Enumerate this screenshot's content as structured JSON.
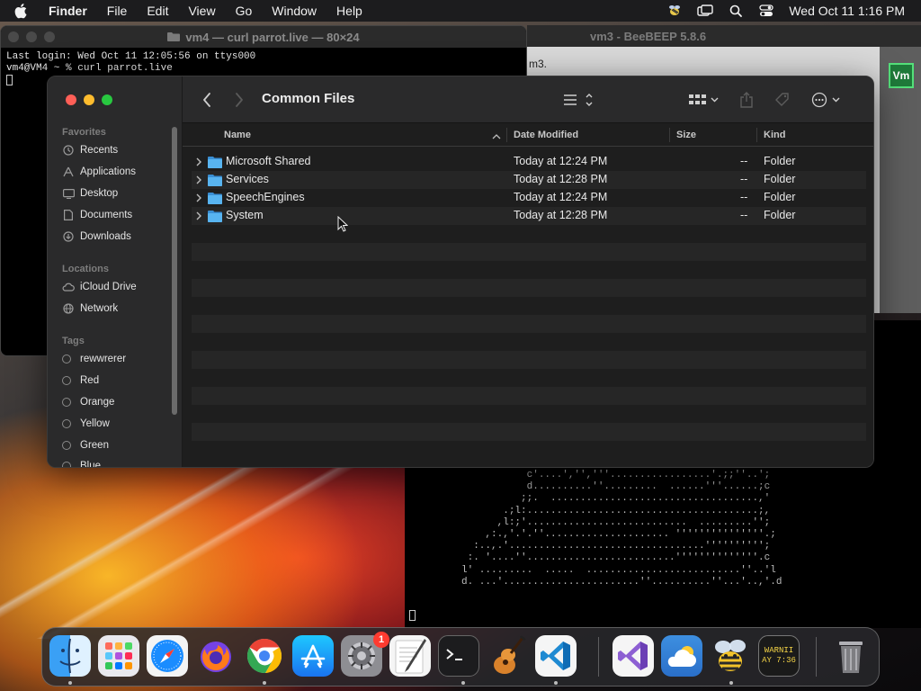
{
  "menubar": {
    "app_name": "Finder",
    "items": [
      "File",
      "Edit",
      "View",
      "Go",
      "Window",
      "Help"
    ],
    "datetime": "Wed Oct 11  1:16 PM"
  },
  "terminal": {
    "title": "vm4 — curl parrot.live — 80×24",
    "line1": "Last login: Wed Oct 11 12:05:56 on ttys000",
    "line2": "vm4@VM4 ~ % curl parrot.live"
  },
  "beebeep": {
    "title": "vm3 - BeeBEEP 5.8.6",
    "text": "m3.",
    "badge": "Vm"
  },
  "parrot": {
    "ascii": "                c'....','','''.................'.;;''..';\n                d..........''.........  ......'''......;c\n               ;;.  ...................................,'\n            .;l:.......................................;,\n           ,l:;'...........................  .........'';\n         ,:.,'.'.''..................... '''''''''''''''.;\n       :..,.'.................................'''''''''';\n      :. '....''.........................''''''''''''''.c\n     l' .........  .....  ..........................''..'l\n     d. ...'.......................''..........''...'..,'.d"
  },
  "finder": {
    "title": "Common Files",
    "sidebar": {
      "favorites_label": "Favorites",
      "favorites": [
        {
          "label": "Recents",
          "icon": "clock-icon"
        },
        {
          "label": "Applications",
          "icon": "applications-icon"
        },
        {
          "label": "Desktop",
          "icon": "desktop-icon"
        },
        {
          "label": "Documents",
          "icon": "document-icon"
        },
        {
          "label": "Downloads",
          "icon": "download-icon"
        }
      ],
      "locations_label": "Locations",
      "locations": [
        {
          "label": "iCloud Drive",
          "icon": "cloud-icon"
        },
        {
          "label": "Network",
          "icon": "globe-icon"
        }
      ],
      "tags_label": "Tags",
      "tags": [
        "rewwrerer",
        "Red",
        "Orange",
        "Yellow",
        "Green",
        "Blue"
      ]
    },
    "columns": {
      "name": "Name",
      "date": "Date Modified",
      "size": "Size",
      "kind": "Kind"
    },
    "rows": [
      {
        "name": "Microsoft Shared",
        "date": "Today at 12:24 PM",
        "size": "--",
        "kind": "Folder"
      },
      {
        "name": "Services",
        "date": "Today at 12:28 PM",
        "size": "--",
        "kind": "Folder"
      },
      {
        "name": "SpeechEngines",
        "date": "Today at 12:24 PM",
        "size": "--",
        "kind": "Folder"
      },
      {
        "name": "System",
        "date": "Today at 12:28 PM",
        "size": "--",
        "kind": "Folder"
      }
    ]
  },
  "dock": {
    "apps": [
      {
        "name": "Finder",
        "icon": "finder-icon"
      },
      {
        "name": "Launchpad",
        "icon": "launchpad-icon"
      },
      {
        "name": "Safari",
        "icon": "safari-icon"
      },
      {
        "name": "Firefox",
        "icon": "firefox-icon"
      },
      {
        "name": "Chrome",
        "icon": "chrome-icon"
      },
      {
        "name": "App Store",
        "icon": "app-store-icon"
      },
      {
        "name": "System Settings",
        "icon": "settings-icon",
        "badge": "1"
      },
      {
        "name": "TextEdit",
        "icon": "textedit-icon"
      },
      {
        "name": "Terminal",
        "icon": "terminal-icon"
      },
      {
        "name": "GarageBand",
        "icon": "garageband-icon"
      },
      {
        "name": "VS Code",
        "icon": "vscode-icon"
      },
      {
        "name": "Visual Studio",
        "icon": "visual-studio-icon"
      },
      {
        "name": "Weather",
        "icon": "weather-icon"
      },
      {
        "name": "BeeBEEP",
        "icon": "bee-icon"
      },
      {
        "name": "Console",
        "icon": "console-icon",
        "text1": "WARNII",
        "text2": "AY 7:36"
      },
      {
        "name": "Trash",
        "icon": "trash-icon"
      }
    ]
  },
  "colors": {
    "close": "#ff5f57",
    "minimize": "#febc2e",
    "zoom": "#28c840",
    "folder": "#58b4f0",
    "badge": "#ff3b30"
  }
}
